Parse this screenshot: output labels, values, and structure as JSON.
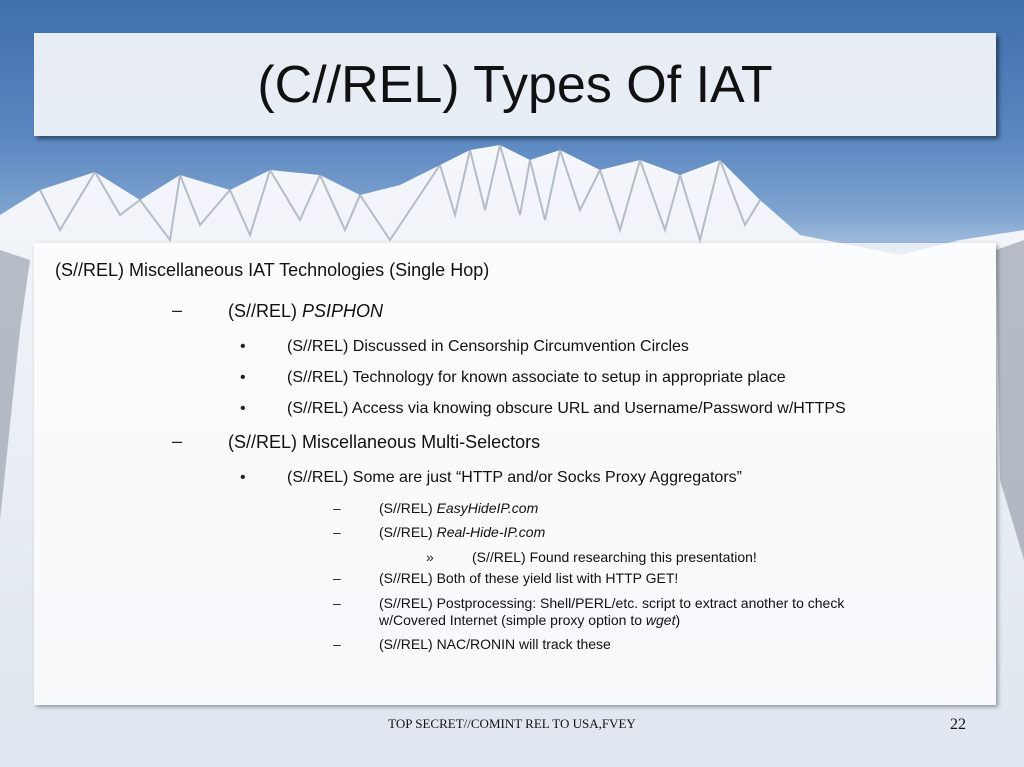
{
  "slide": {
    "title": "(C//REL) Types Of IAT",
    "heading": "(S//REL) Miscellaneous IAT Technologies (Single Hop)",
    "sections": [
      {
        "label_prefix": "(S//REL) ",
        "label_italic": "PSIPHON",
        "bullets": [
          "(S//REL) Discussed in Censorship Circumvention Circles",
          "(S//REL) Technology for known associate to setup in appropriate place",
          "(S//REL) Access via knowing obscure URL and Username/Password w/HTTPS"
        ]
      },
      {
        "label": "(S//REL) Miscellaneous Multi-Selectors",
        "bullet": "(S//REL) Some are just “HTTP and/or Socks Proxy Aggregators”",
        "subitems": {
          "item1_prefix": "(S//REL) ",
          "item1_italic": "EasyHideIP.com",
          "item2_prefix": "(S//REL) ",
          "item2_italic": "Real-Hide-IP.com",
          "item2_sub": "(S//REL) Found researching this presentation!",
          "item3": "(S//REL) Both of these yield list with HTTP GET!",
          "item4_line1": "(S//REL) Postprocessing: Shell/PERL/etc. script to extract another to check",
          "item4_line2_prefix": "w/Covered Internet (simple proxy option to ",
          "item4_line2_italic": "wget",
          "item4_line2_suffix": ")",
          "item5": "(S//REL) NAC/RONIN will track these"
        }
      }
    ],
    "markers": {
      "dash": "–",
      "bullet": "•",
      "arrow": "»"
    },
    "footer": "TOP SECRET//COMINT REL TO USA,FVEY",
    "page_number": "22"
  }
}
